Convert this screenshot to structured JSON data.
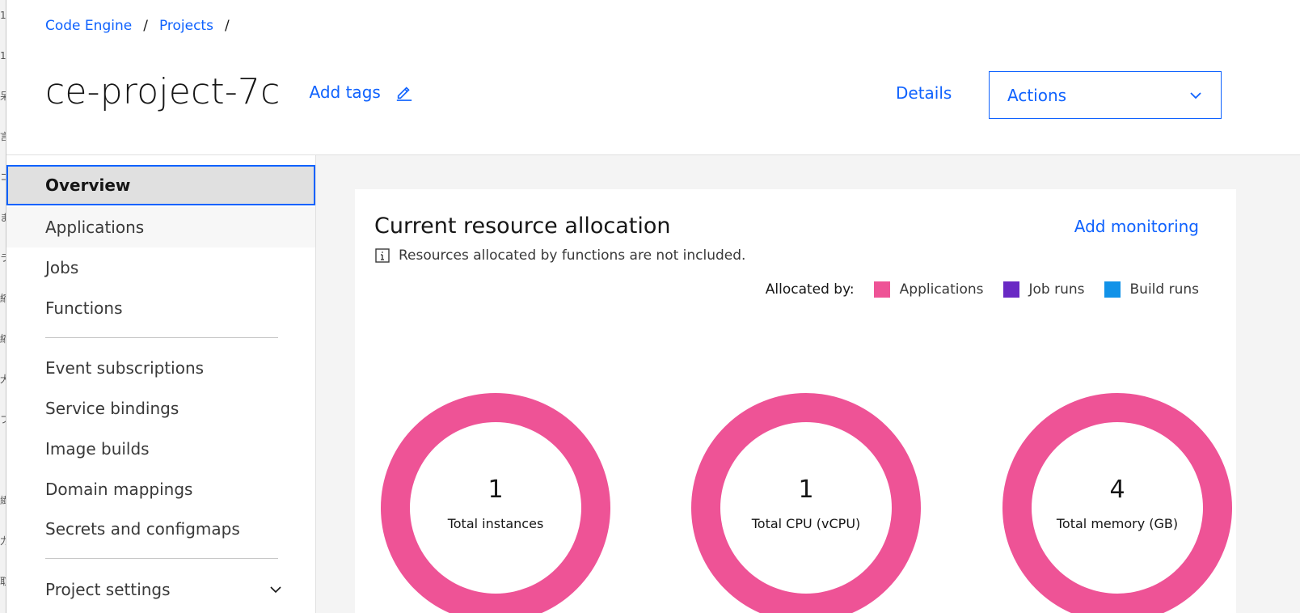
{
  "background_window": {
    "strip_text": [
      "1",
      "1",
      "呆",
      "言",
      "コ",
      "ま",
      "ラ",
      "縮",
      "縮",
      "大",
      "フ",
      "",
      "繊",
      "力",
      "取"
    ]
  },
  "breadcrumb": {
    "items": [
      "Code Engine",
      "Projects"
    ],
    "separator": "/"
  },
  "header": {
    "title": "ce-project-7c",
    "add_tags_label": "Add tags",
    "details_label": "Details",
    "actions_label": "Actions"
  },
  "sidenav": {
    "items": [
      {
        "label": "Overview",
        "active": true
      },
      {
        "label": "Applications"
      },
      {
        "label": "Jobs"
      },
      {
        "label": "Functions"
      },
      {
        "label": "Event subscriptions"
      },
      {
        "label": "Service bindings"
      },
      {
        "label": "Image builds"
      },
      {
        "label": "Domain mappings"
      },
      {
        "label": "Secrets and configmaps"
      },
      {
        "label": "Project settings"
      }
    ]
  },
  "card": {
    "title": "Current resource allocation",
    "add_monitoring_label": "Add monitoring",
    "info_note": "Resources allocated by functions are not included.",
    "legend": {
      "label": "Allocated by:",
      "items": [
        {
          "name": "Applications",
          "color": "#ee5396"
        },
        {
          "name": "Job runs",
          "color": "#6929c4"
        },
        {
          "name": "Build runs",
          "color": "#1192e8"
        }
      ]
    },
    "metrics": [
      {
        "value": "1",
        "label": "Total instances",
        "color": "#ee5396"
      },
      {
        "value": "1",
        "label": "Total CPU (vCPU)",
        "color": "#ee5396"
      },
      {
        "value": "4",
        "label": "Total memory (GB)",
        "color": "#ee5396"
      }
    ]
  },
  "colors": {
    "accent": "#0f62fe",
    "donut": "#ee5396"
  }
}
